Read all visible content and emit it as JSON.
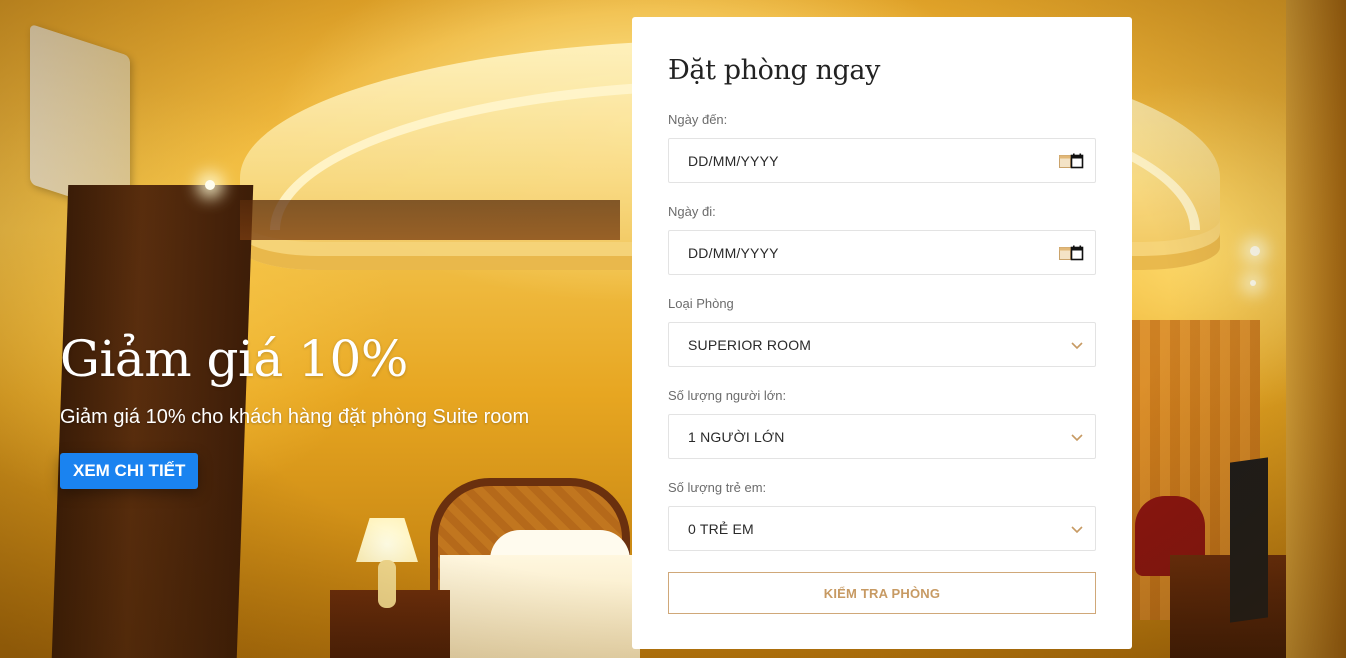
{
  "hero": {
    "title": "Giảm giá 10%",
    "subtitle": "Giảm giá 10% cho khách hàng đặt phòng Suite room",
    "button_label": "XEM CHI TIẾT"
  },
  "booking": {
    "title": "Đặt phòng ngay",
    "arrival": {
      "label": "Ngày đến:",
      "value": "DD/MM/YYYY",
      "icon": "calendar-icon"
    },
    "departure": {
      "label": "Ngày đi:",
      "value": "DD/MM/YYYY",
      "icon": "calendar-icon"
    },
    "room_type": {
      "label": "Loại Phòng",
      "value": "SUPERIOR ROOM",
      "icon": "chevron-down-icon"
    },
    "adults": {
      "label": "Số lượng người lớn:",
      "value": "1 NGƯỜI LỚN",
      "icon": "chevron-down-icon"
    },
    "children": {
      "label": "Số lượng trẻ em:",
      "value": "0 TRẺ EM",
      "icon": "chevron-down-icon"
    },
    "submit_label": "KIỂM TRA PHÒNG"
  },
  "colors": {
    "primary_button": "#1a83f0",
    "accent_gold": "#c79a63",
    "card_background": "#ffffff"
  }
}
